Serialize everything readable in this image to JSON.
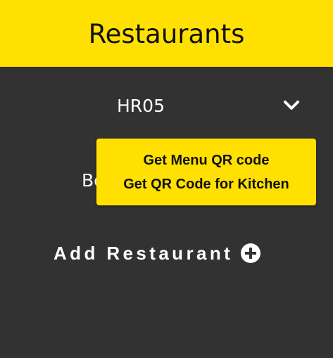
{
  "header": {
    "title": "Restaurants"
  },
  "restaurant": {
    "selected": "HR05",
    "expand_icon": "chevron-down-icon",
    "partial_label": "Bo"
  },
  "menu": {
    "items": [
      {
        "label": "Get Menu QR code"
      },
      {
        "label": "Get QR Code for Kitchen"
      }
    ]
  },
  "actions": {
    "add_label": "Add Restaurant",
    "add_icon": "plus-circle-icon"
  },
  "colors": {
    "accent": "#FFE000",
    "background": "#323232",
    "text_light": "#FFFFFF",
    "text_dark": "#111111"
  }
}
